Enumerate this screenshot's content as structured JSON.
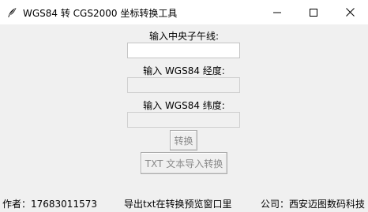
{
  "window": {
    "title": "WGS84 转 CGS2000 坐标转换工具"
  },
  "form": {
    "meridian_label": "输入中央子午线:",
    "meridian_value": "",
    "longitude_label": "输入 WGS84 经度:",
    "longitude_value": "",
    "latitude_label": "输入 WGS84 纬度:",
    "latitude_value": ""
  },
  "buttons": {
    "convert_label": "转换",
    "txt_import_label": "TXT 文本导入转换"
  },
  "footer": {
    "author": "作者：17683011573",
    "note": "导出txt在转换预览窗口里",
    "company": "公司：西安迈图数码科技"
  },
  "icons": {
    "app": "feather-icon",
    "minimize": "minimize-icon",
    "maximize": "maximize-icon",
    "close": "close-icon"
  }
}
